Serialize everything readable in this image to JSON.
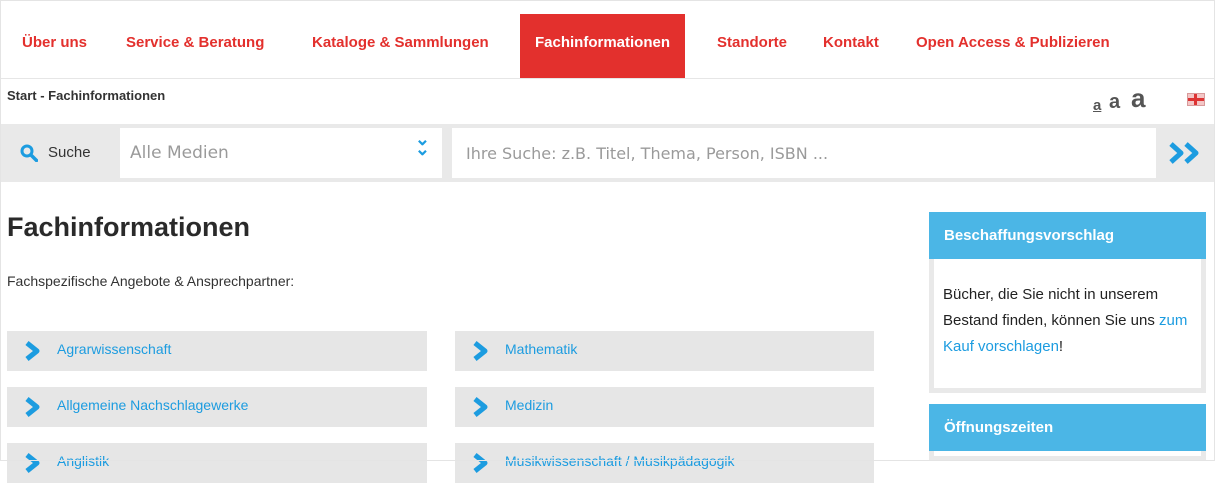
{
  "nav": {
    "items": [
      {
        "label": "Über uns"
      },
      {
        "label": "Service & Beratung"
      },
      {
        "label": "Kataloge & Sammlungen"
      },
      {
        "label": "Fachinformationen",
        "active": true
      },
      {
        "label": "Standorte"
      },
      {
        "label": "Kontakt"
      },
      {
        "label": "Open Access & Publizieren"
      }
    ]
  },
  "breadcrumb": "Start - Fachinformationen",
  "font_size_controls": [
    "a",
    "a",
    "a"
  ],
  "language_flag_icon": "uk-flag-icon",
  "search": {
    "label": "Suche",
    "media_value": "Alle Medien",
    "placeholder": "Ihre Suche: z.B. Titel, Thema, Person, ISBN ..."
  },
  "main": {
    "title": "Fachinformationen",
    "intro": "Fachspezifische Angebote & Ansprechpartner:",
    "subjects_left": [
      "Agrarwissenschaft",
      "Allgemeine Nachschlagewerke",
      "Anglistik"
    ],
    "subjects_right": [
      "Mathematik",
      "Medizin",
      "Musikwissenschaft / Musikpädagogik"
    ]
  },
  "sidebar": {
    "box1": {
      "title": "Beschaffungsvorschlag",
      "text_before": "Bücher, die Sie nicht in unserem Bestand finden, können Sie uns",
      "link": "zum Kauf vorschlagen",
      "text_after": "!"
    },
    "box2": {
      "title": "Öffnungszeiten"
    }
  },
  "colors": {
    "accent_red": "#e3302d",
    "accent_blue": "#1c9ce0",
    "box_header_blue": "#4bb6e6"
  }
}
